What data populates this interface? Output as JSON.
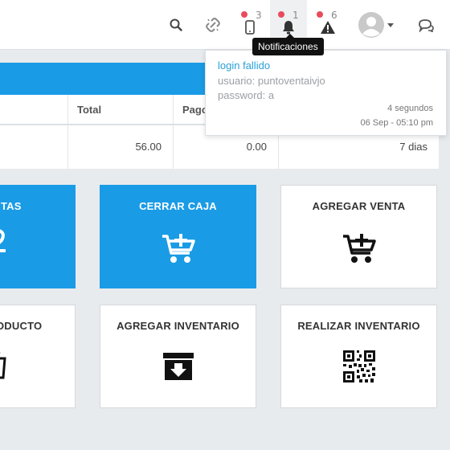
{
  "navbar": {
    "badges": {
      "mobile": "3",
      "notifications": "1",
      "alerts": "6"
    },
    "tooltip": "Notificaciones"
  },
  "notification": {
    "title": "login fallido",
    "user_line": "usuario: puntoventaivjo",
    "password_line": "password: a",
    "elapsed": "4 segundos",
    "date": "06 Sep - 05:10 pm"
  },
  "table": {
    "headers": [
      "Total",
      "Pago"
    ],
    "row": {
      "total": "56.00",
      "paid": "0.00",
      "days": "7 dias"
    }
  },
  "cards": [
    {
      "label": "TAS",
      "style": "blue",
      "icon": "digit-icon"
    },
    {
      "label": "CERRAR CAJA",
      "style": "blue",
      "icon": "cart-plus-icon"
    },
    {
      "label": "AGREGAR VENTA",
      "style": "white",
      "icon": "cart-plus-icon"
    },
    {
      "label": "ODUCTO",
      "style": "white",
      "icon": "shopping-bag-icon"
    },
    {
      "label": "AGREGAR INVENTARIO",
      "style": "white",
      "icon": "archive-download-icon"
    },
    {
      "label": "REALIZAR INVENTARIO",
      "style": "white",
      "icon": "qr-code-icon"
    }
  ],
  "colors": {
    "primary": "#1a9be6",
    "badge": "#e84c5c",
    "link": "#2aa0d8"
  }
}
